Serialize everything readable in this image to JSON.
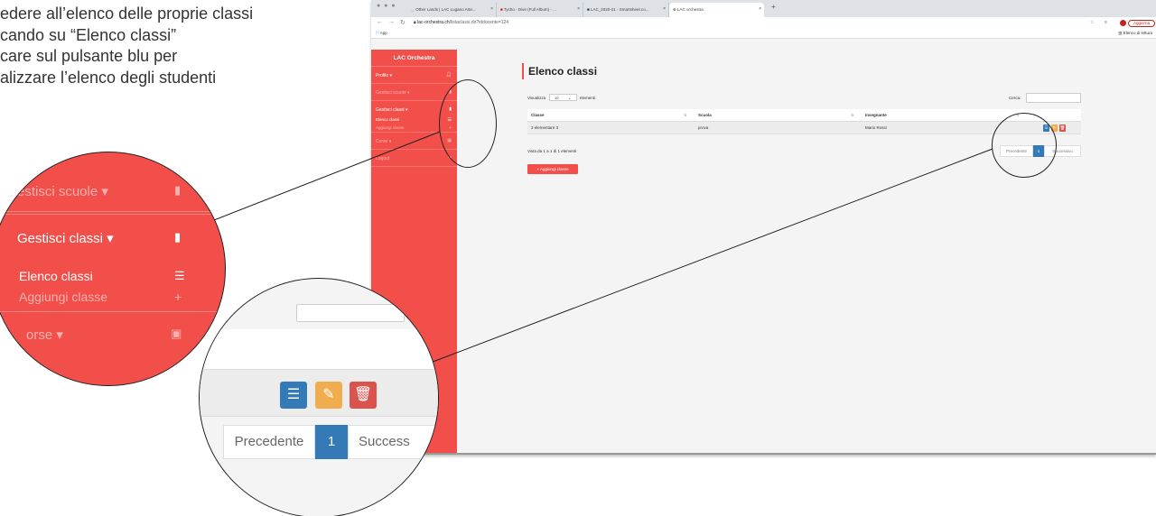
{
  "instructions": {
    "lines": [
      "edere all’elenco delle proprie classi",
      "cando su “Elenco classi”",
      "care sul pulsante blu per",
      "alizzare l’elenco degli studenti"
    ]
  },
  "browser": {
    "tabs": [
      {
        "label": "Other Lands | LAC Lugano Arte...",
        "icon": "lac-favicon"
      },
      {
        "label": "Tycho - Dive (Full Album) - ...",
        "icon": "youtube-icon"
      },
      {
        "label": "LAC_2020-21 - Smartsheet.co...",
        "icon": "smartsheet-icon"
      },
      {
        "label": "LAC orchestra",
        "icon": "globe-icon"
      }
    ],
    "url_domain": "lac-orchestra.ch",
    "url_path": "/listaclassi.do?iddocente=124",
    "update_label": "Aggiorna",
    "bookmarks_apps": "App",
    "reading_list": "Elenco di lettura",
    "colors": {
      "tabbar": "#dee1e6",
      "update": "#c5221f"
    }
  },
  "sidebar": {
    "brand": "LAC Orchestra",
    "items": [
      {
        "label": "Profilo ▾",
        "icon": "user-icon",
        "faded": false
      },
      {
        "label": "Gestisci scuole ▾",
        "icon": "book-icon",
        "faded": true
      },
      {
        "label": "Gestisci classi ▾",
        "icon": "book-icon",
        "faded": false
      },
      {
        "label": "Corse ▾",
        "icon": "briefcase-icon",
        "faded": true
      },
      {
        "label": "Logout",
        "icon": "logout-icon",
        "faded": true
      }
    ],
    "subitems": [
      {
        "label": "Elenco classi",
        "icon": "list-icon",
        "faded": false
      },
      {
        "label": "Aggiungi classe",
        "icon": "plus-icon",
        "faded": true
      }
    ],
    "colors": {
      "background": "#f24f4b"
    }
  },
  "main": {
    "title": "Elenco classi",
    "show_label": "Visualizza",
    "show_value": "10",
    "show_suffix": "elementi",
    "search_label": "Cerca:",
    "table": {
      "headers": [
        "Classe",
        "Scuola",
        "Insegnante"
      ],
      "rows": [
        {
          "classe": "3 elementare 3",
          "scuola": "prova",
          "insegnante": "Mario Rossi"
        }
      ]
    },
    "info": "Vista da 1 a 1 di 1 elementi",
    "pagination": {
      "prev": "Precedente",
      "current": "1",
      "next": "Successivo"
    },
    "add_button": "+ Aggiungi classe",
    "colors": {
      "blue": "#337ab7",
      "orange": "#f0ad4e",
      "red": "#d9534f"
    }
  },
  "zoom_left": {
    "items": [
      {
        "label": "estisci scuole ▾",
        "icon": "book-icon"
      },
      {
        "label": "Gestisci classi ▾",
        "icon": "book-icon"
      },
      {
        "label": "Elenco classi",
        "icon": "list-icon"
      },
      {
        "label": "Aggiungi classe",
        "icon": "plus-icon"
      },
      {
        "label": "orse ▾",
        "icon": "briefcase-icon"
      }
    ]
  },
  "zoom_right": {
    "prev": "Precedente",
    "current": "1",
    "next": "Success"
  }
}
